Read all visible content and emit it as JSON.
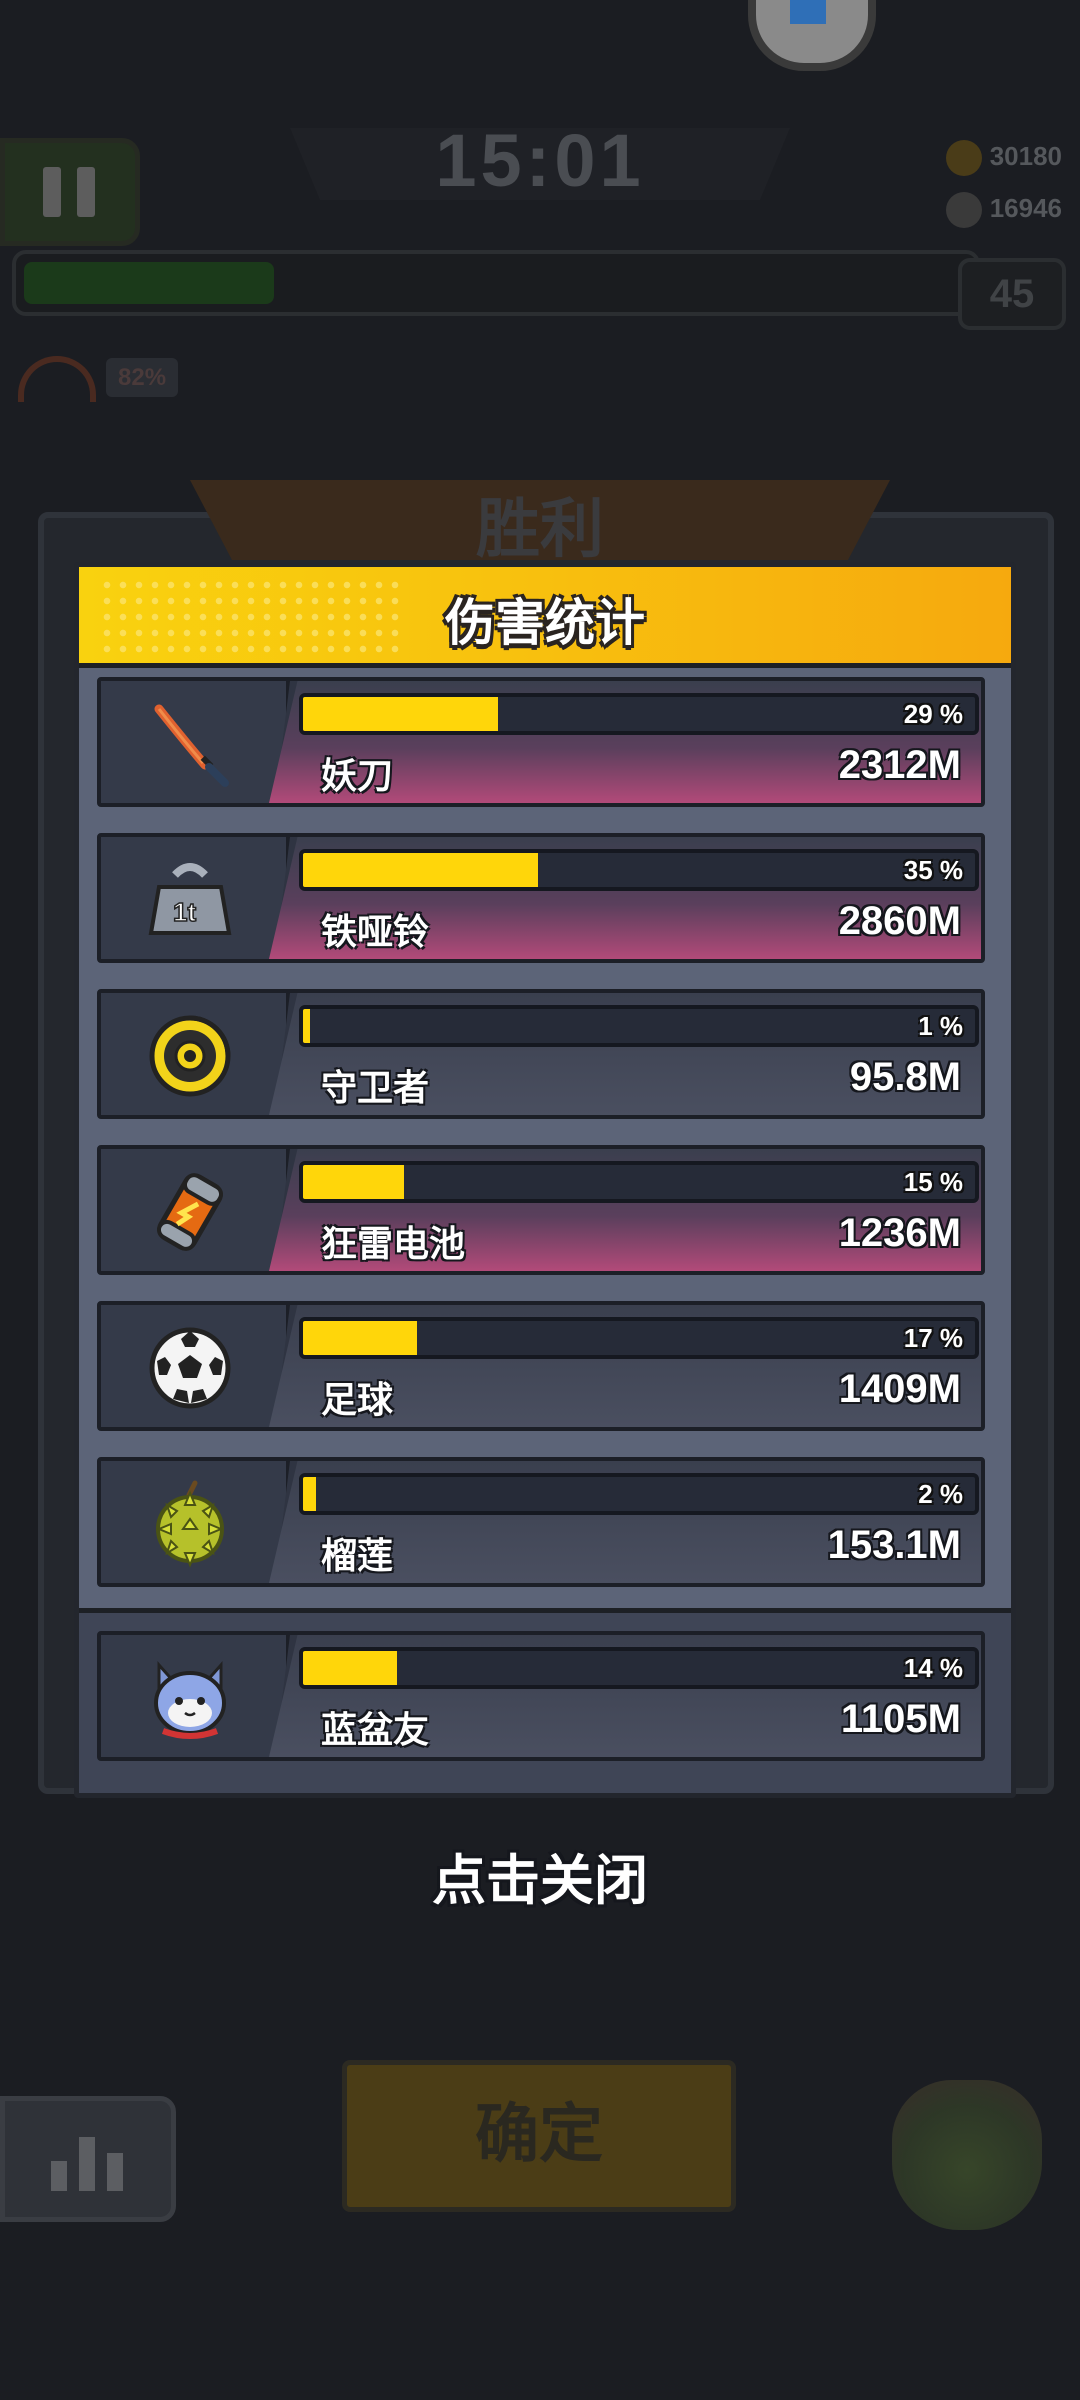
{
  "hud": {
    "timer": "15:01",
    "gold": "30180",
    "gems": "16946",
    "level": "45",
    "speed_pct": "82%",
    "xp_progress": 0.26
  },
  "victory_title": "胜利",
  "panel": {
    "title": "伤害统计",
    "weapons": [
      {
        "name": "妖刀",
        "percent_label": "29 %",
        "percent": 29,
        "damage": "2312M",
        "highlight": true,
        "icon": "demon-blade-icon"
      },
      {
        "name": "铁哑铃",
        "percent_label": "35 %",
        "percent": 35,
        "damage": "2860M",
        "highlight": true,
        "icon": "iron-dumbbell-icon"
      },
      {
        "name": "守卫者",
        "percent_label": "1 %",
        "percent": 1,
        "damage": "95.8M",
        "highlight": false,
        "icon": "guardian-icon"
      },
      {
        "name": "狂雷电池",
        "percent_label": "15 %",
        "percent": 15,
        "damage": "1236M",
        "highlight": true,
        "icon": "thunder-battery-icon"
      },
      {
        "name": "足球",
        "percent_label": "17 %",
        "percent": 17,
        "damage": "1409M",
        "highlight": false,
        "icon": "soccer-ball-icon"
      },
      {
        "name": "榴莲",
        "percent_label": "2 %",
        "percent": 2,
        "damage": "153.1M",
        "highlight": false,
        "icon": "durian-icon"
      }
    ],
    "pet": {
      "name": "蓝盆友",
      "percent_label": "14 %",
      "percent": 14,
      "damage": "1105M",
      "highlight": false,
      "icon": "blue-cat-pet-icon"
    }
  },
  "close_hint": "点击关闭",
  "confirm_label": "确定",
  "colors": {
    "bar_fill": "#ffd60a",
    "header_yellow": "#f9d20f",
    "header_orange": "#f6a90e",
    "highlight_pink": "#b24a79"
  }
}
